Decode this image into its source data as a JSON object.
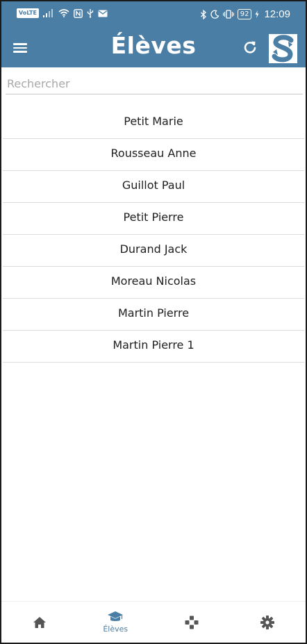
{
  "status_bar": {
    "volte": "VoLTE",
    "battery": "92",
    "time": "12:09"
  },
  "app_bar": {
    "title": "Élèves"
  },
  "search": {
    "placeholder": "Rechercher",
    "value": ""
  },
  "students": [
    {
      "name": "Petit Marie"
    },
    {
      "name": "Rousseau Anne"
    },
    {
      "name": "Guillot Paul"
    },
    {
      "name": "Petit Pierre"
    },
    {
      "name": "Durand Jack"
    },
    {
      "name": "Moreau Nicolas"
    },
    {
      "name": "Martin Pierre"
    },
    {
      "name": "Martin Pierre 1"
    }
  ],
  "bottom_nav": {
    "items": [
      {
        "icon": "home-icon",
        "label": ""
      },
      {
        "icon": "graduation-cap-icon",
        "label": "Élèves",
        "active": true
      },
      {
        "icon": "game-icon",
        "label": ""
      },
      {
        "icon": "gear-icon",
        "label": ""
      }
    ]
  },
  "colors": {
    "primary": "#4a7ea4",
    "icon_dark": "#555555"
  }
}
